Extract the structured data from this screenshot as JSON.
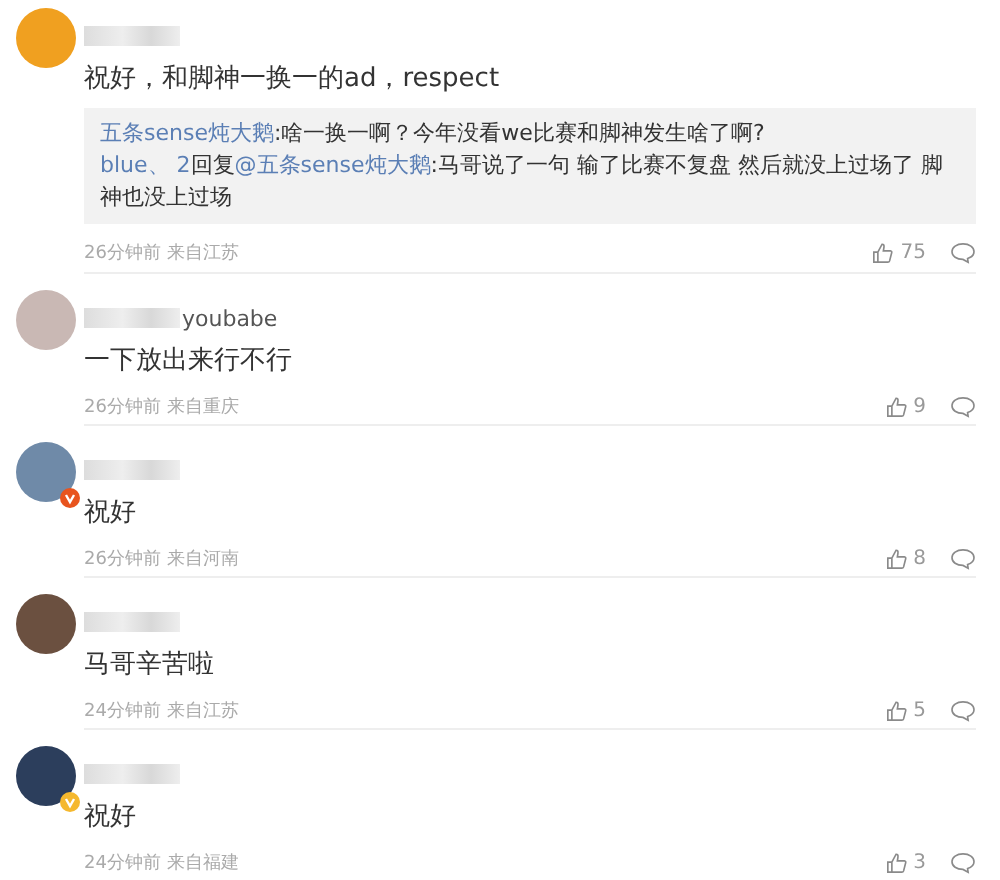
{
  "comments": [
    {
      "color": "#f0a020",
      "kind": "plain",
      "text": "祝好，和脚神一换一的ad，respect",
      "replies": [
        {
          "author": "五条sense炖大鹅",
          "text": ":啥一换一啊？今年没看we比赛和脚神发生啥了啊?"
        },
        {
          "author": "blue、 2",
          "reply_word": "回复",
          "mention": "@五条sense炖大鹅",
          "text": ":马哥说了一句 输了比赛不复盘 然后就没上过场了 脚神也没上过场"
        }
      ],
      "time": "26分钟前",
      "location": "来自江苏",
      "likes": "75"
    },
    {
      "color": "#c9b8b4",
      "kind": "plain",
      "username_visible": "youbabe",
      "text": "一下放出来行不行",
      "time": "26分钟前",
      "location": "来自重庆",
      "likes": "9"
    },
    {
      "color": "#6f8aa8",
      "kind": "red_verified",
      "text": "祝好",
      "time": "26分钟前",
      "location": "来自河南",
      "likes": "8"
    },
    {
      "color": "#6b5040",
      "kind": "plain",
      "text": "马哥辛苦啦",
      "time": "24分钟前",
      "location": "来自江苏",
      "likes": "5"
    },
    {
      "color": "#2c3e5c",
      "kind": "gold_verified",
      "text": "祝好",
      "time": "24分钟前",
      "location": "来自福建",
      "likes": "3"
    }
  ]
}
